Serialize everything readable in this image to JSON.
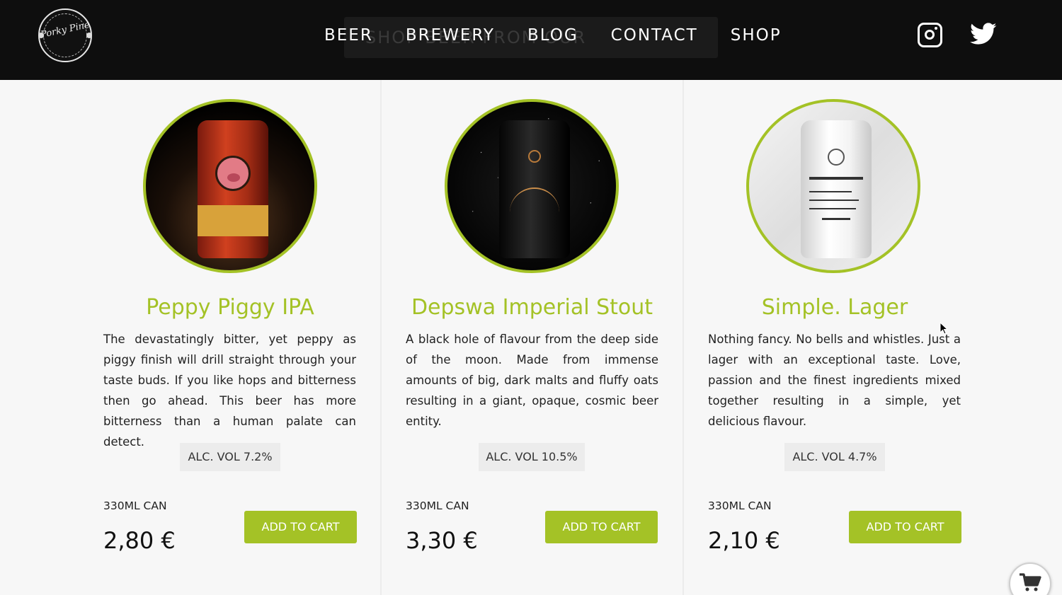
{
  "header": {
    "logo_text": "Porky Pine",
    "ghost_text": "SHOP BEER FROM OUR",
    "nav": [
      {
        "label": "BEER"
      },
      {
        "label": "BREWERY"
      },
      {
        "label": "BLOG"
      },
      {
        "label": "CONTACT"
      },
      {
        "label": "SHOP"
      }
    ],
    "social": [
      "instagram-icon",
      "twitter-icon"
    ]
  },
  "accent_color": "#a4c226",
  "products": [
    {
      "name": "Peppy Piggy IPA",
      "description": "The devastatingly bitter, yet peppy as piggy finish will drill straight through your taste buds. If you like hops and bitterness then go ahead. This beer has more bitterness than a human palate  can detect.",
      "abv": "ALC. VOL 7.2%",
      "size": "330ML CAN",
      "price": "2,80 €",
      "button": "ADD TO CART"
    },
    {
      "name": "Depswa Imperial Stout",
      "description": "A black hole of flavour from the deep side of the moon. Made from immense amounts of big, dark malts and fluffy oats resulting in a giant, opaque, cosmic beer entity.",
      "abv": "ALC. VOL 10.5%",
      "size": "330ML CAN",
      "price": "3,30 €",
      "button": "ADD TO CART"
    },
    {
      "name": "Simple. Lager",
      "description": "Nothing fancy. No bells and whistles. Just a lager with an exceptional taste. Love, passion and the finest ingredients mixed together resulting in a simple, yet delicious flavour.",
      "abv": "ALC. VOL 4.7%",
      "size": "330ML CAN",
      "price": "2,10 €",
      "button": "ADD TO CART"
    }
  ]
}
